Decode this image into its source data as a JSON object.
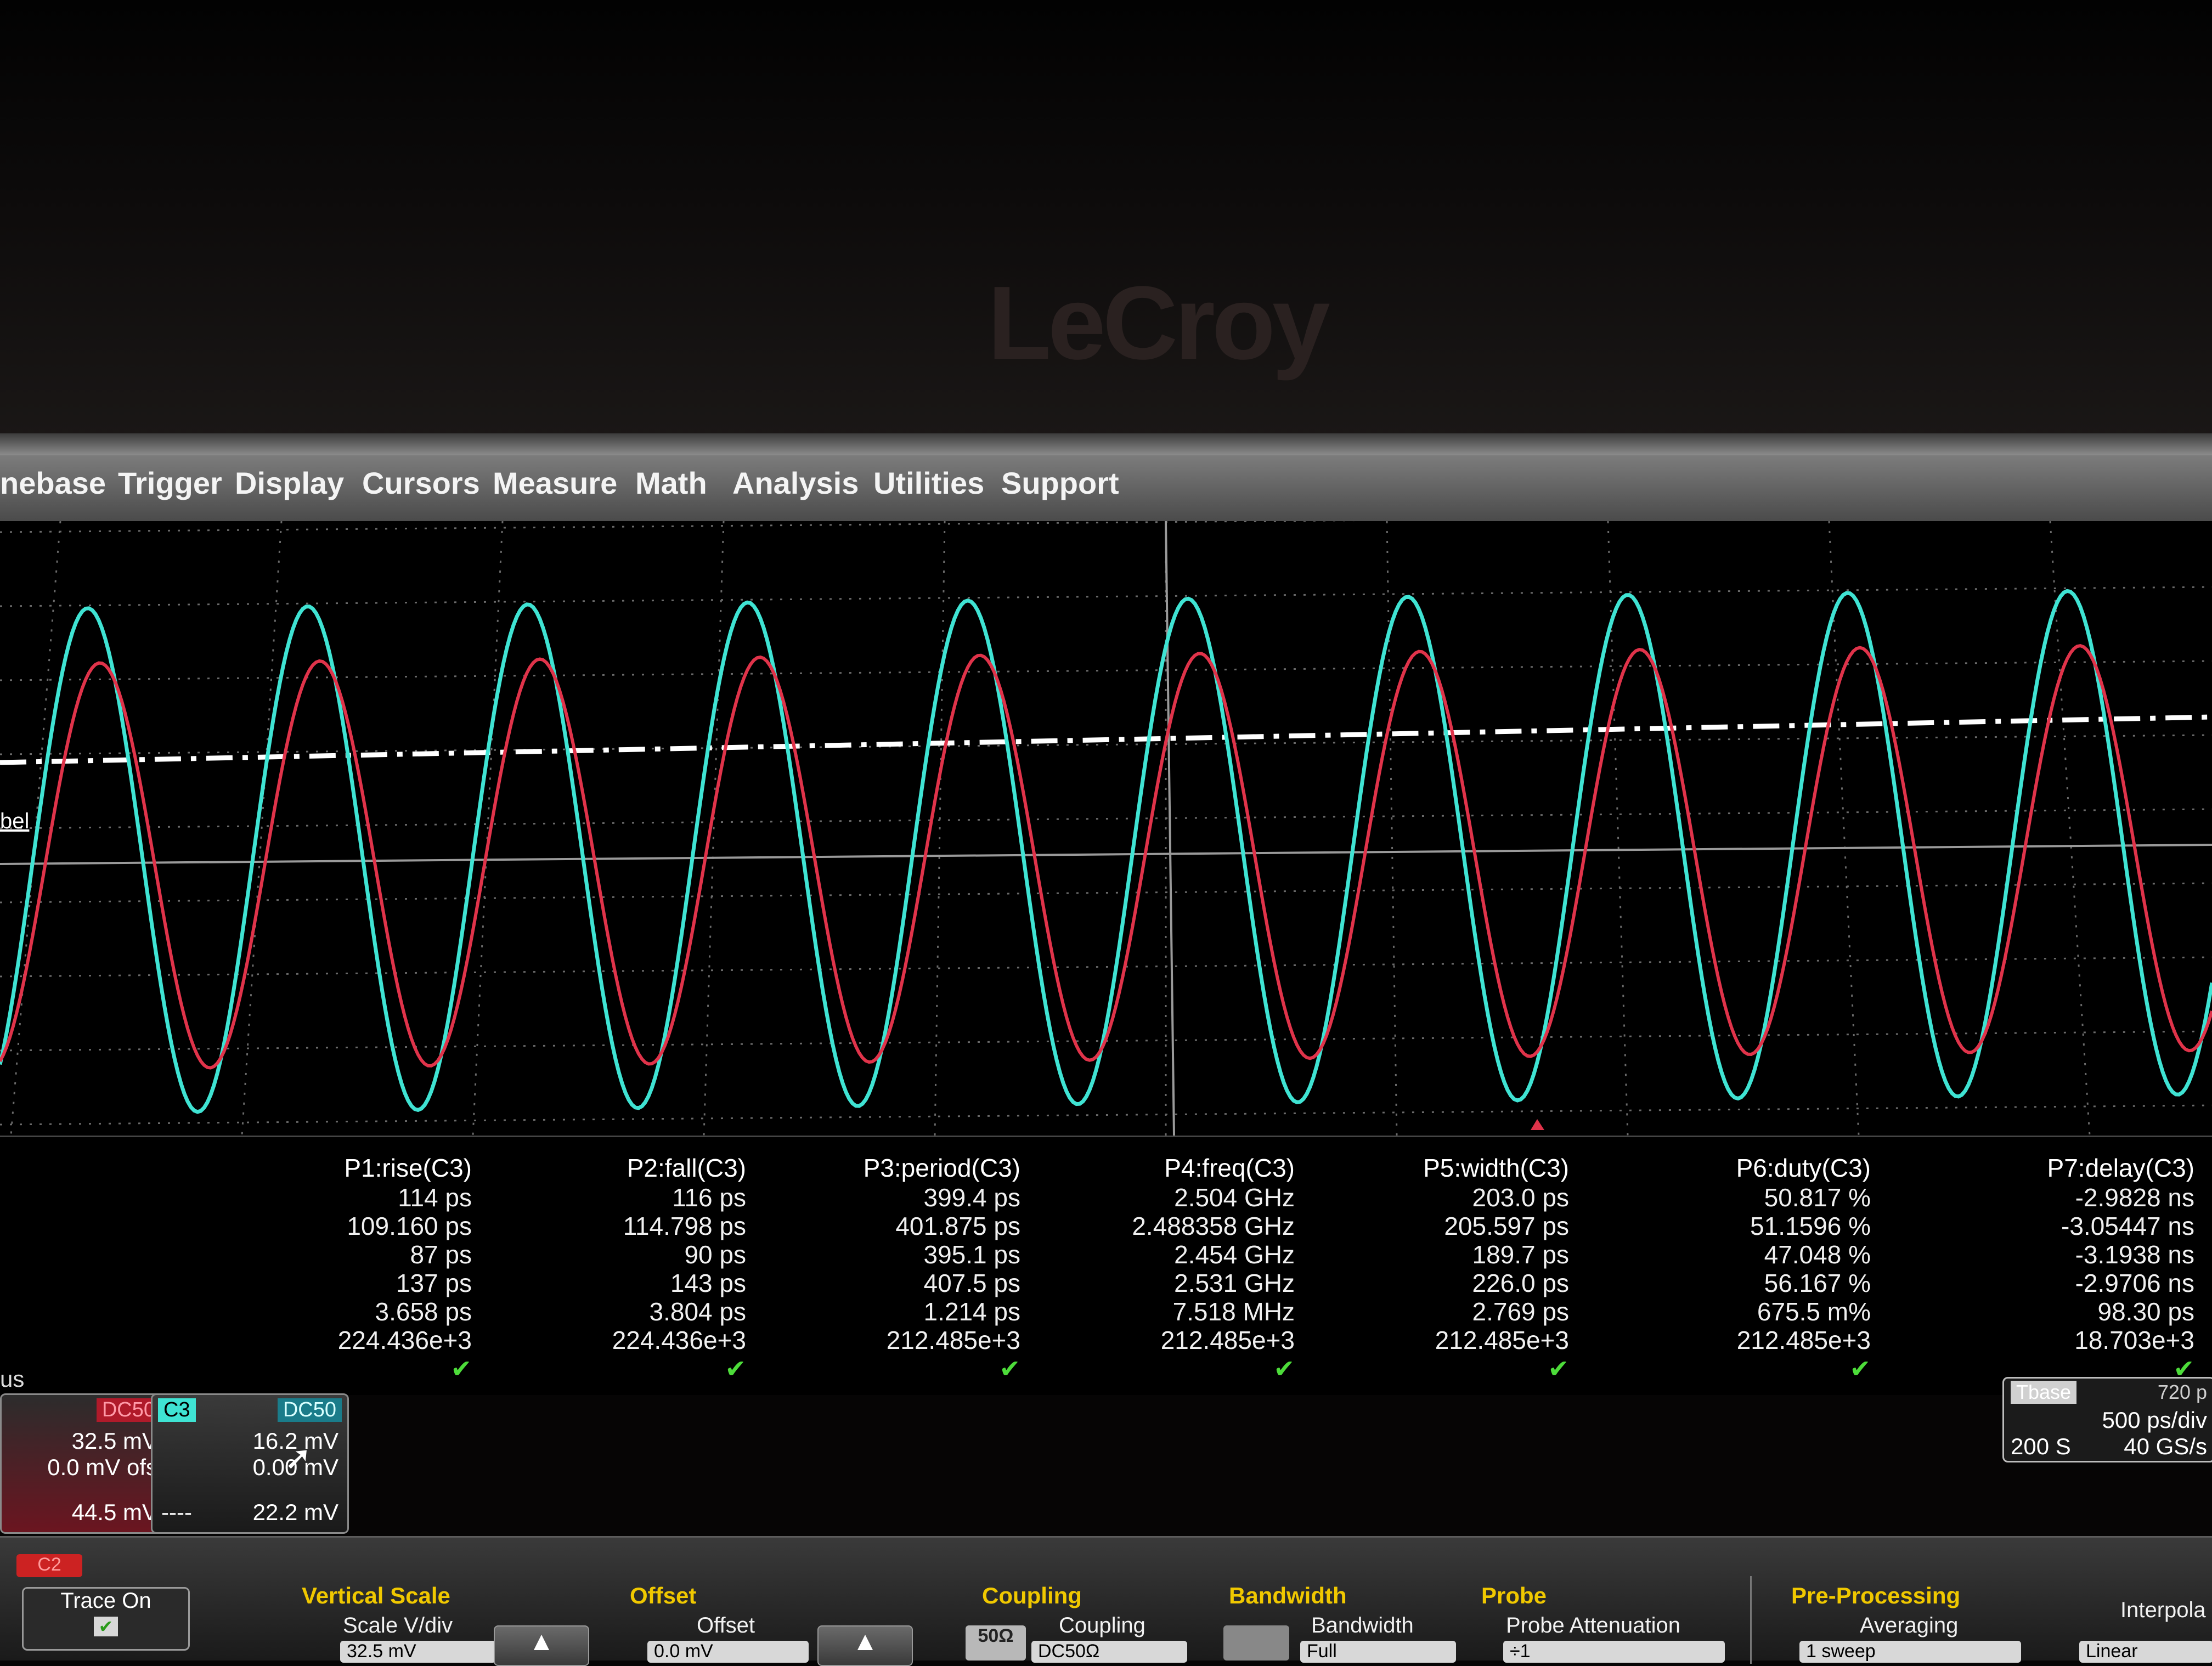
{
  "brand": "LeCroy",
  "menu": [
    "nebase",
    "Trigger",
    "Display",
    "Cursors",
    "Measure",
    "Math",
    "Analysis",
    "Utilities",
    "Support"
  ],
  "grid_label": "bel",
  "colors": {
    "trace_c2": "#e0334a",
    "trace_c3": "#3fe3d3",
    "grid": "#6a6a6a",
    "menu_text": "#f4f4f4",
    "group_title": "#f0c800",
    "check": "#4ddc3a"
  },
  "params": [
    {
      "name": "P1:rise(C3)",
      "values": [
        "114 ps",
        "109.160 ps",
        "87 ps",
        "137 ps",
        "3.658 ps",
        "224.436e+3"
      ]
    },
    {
      "name": "P2:fall(C3)",
      "values": [
        "116 ps",
        "114.798 ps",
        "90 ps",
        "143 ps",
        "3.804 ps",
        "224.436e+3"
      ]
    },
    {
      "name": "P3:period(C3)",
      "values": [
        "399.4 ps",
        "401.875 ps",
        "395.1 ps",
        "407.5 ps",
        "1.214 ps",
        "212.485e+3"
      ]
    },
    {
      "name": "P4:freq(C3)",
      "values": [
        "2.504 GHz",
        "2.488358 GHz",
        "2.454 GHz",
        "2.531 GHz",
        "7.518 MHz",
        "212.485e+3"
      ]
    },
    {
      "name": "P5:width(C3)",
      "values": [
        "203.0 ps",
        "205.597 ps",
        "189.7 ps",
        "226.0 ps",
        "2.769 ps",
        "212.485e+3"
      ]
    },
    {
      "name": "P6:duty(C3)",
      "values": [
        "50.817 %",
        "51.1596 %",
        "47.048 %",
        "56.167 %",
        "675.5 m%",
        "212.485e+3"
      ]
    },
    {
      "name": "P7:delay(C3)",
      "values": [
        "-2.9828 ns",
        "-3.05447 ns",
        "-3.1938 ns",
        "-2.9706 ns",
        "98.30 ps",
        "18.703e+3"
      ]
    }
  ],
  "status_label": "us",
  "channels": [
    {
      "tag": "C2",
      "coupling": "DC50",
      "scale": "32.5 mV",
      "offset": "0.0 mV ofs",
      "footer_left": "",
      "footer_right": "44.5 mV"
    },
    {
      "tag": "C3",
      "coupling": "DC50",
      "scale": "16.2 mV",
      "offset": "0.00 mV",
      "footer_left": "----",
      "footer_right": "22.2 mV"
    }
  ],
  "timebase": {
    "title": "Tbase",
    "value": "720 p",
    "scale": "500 ps/div",
    "samples": "200 S",
    "rate": "40 GS/s"
  },
  "bottom": {
    "c2_tab": "C2",
    "trace_on": "Trace On",
    "vertical_scale": {
      "title": "Vertical Scale",
      "label": "Scale V/div",
      "value": "32.5 mV"
    },
    "offset": {
      "title": "Offset",
      "label": "Offset",
      "value": "0.0 mV"
    },
    "coupling": {
      "title": "Coupling",
      "badge": "50Ω",
      "label": "Coupling",
      "value": "DC50Ω"
    },
    "bandwidth": {
      "title": "Bandwidth",
      "label": "Bandwidth",
      "value": "Full"
    },
    "probe": {
      "title": "Probe",
      "label": "Probe Attenuation",
      "value": "÷1"
    },
    "preproc": {
      "title": "Pre-Processing",
      "label": "Averaging",
      "value": "1 sweep"
    },
    "interp": {
      "title": "",
      "label": "Interpola",
      "value": "Linear"
    }
  }
}
